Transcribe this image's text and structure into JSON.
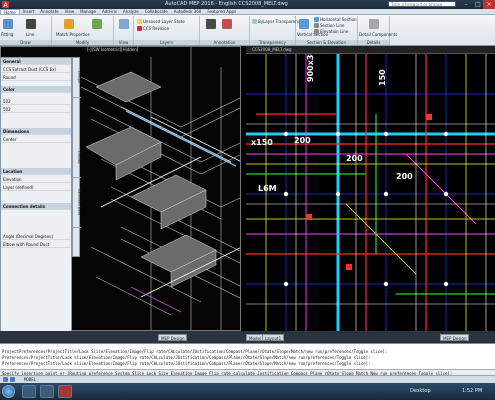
{
  "title_bar": {
    "title": "AutoCAD MEP 2016 - English   CCS2008_MELT.dwg",
    "search_placeholder": "Type a keyword or phrase"
  },
  "menu_tabs": [
    "Home",
    "Insert",
    "Annotate",
    "View",
    "Manage",
    "Add-ins",
    "Analyze",
    "Collaborate",
    "Autodesk 360",
    "Featured Apps"
  ],
  "ribbon": {
    "panels": [
      "Draw",
      "Modify",
      "View",
      "Layers",
      "Annotation",
      "Transparency",
      "Section & Elevation",
      "Details"
    ],
    "buttons": {
      "line": "Line",
      "fitting": "Fitting",
      "match_properties": "Match Properties",
      "unsaved_layer_state": "Unsaved Layer State",
      "ccs_revision": "CCS Revision",
      "bylayer_transparency": "ByLayer Transparency",
      "horizontal_section": "Horizontal Section",
      "section_line": "Section Line",
      "elevation_line": "Elevation Line",
      "vertical_section": "Vertical Section",
      "detail_components": "Detail Components"
    }
  },
  "left_viewport": {
    "label": "[-][SW Isometric][Hidden]"
  },
  "right_viewport": {
    "tab": "CCS2008_MELT.dwg",
    "dims": [
      "900x300",
      "200",
      "200",
      "150",
      "x150",
      "200",
      "L6M"
    ]
  },
  "properties_palette": {
    "rows": [
      "General",
      "CCS Extract Duct (CCS Ex)",
      "Round",
      "Color",
      "502",
      "502",
      "Dimensions",
      "Center",
      "Location",
      "Elevation",
      "Layer (defined)",
      "Connection details",
      "Angle (Decimal Degrees)",
      "Elbow with Round Duct"
    ],
    "side_tabs": [
      "Design",
      "Display",
      "Extended Data"
    ]
  },
  "layout_tabs": [
    "Model",
    "Layout1",
    "MEP Design"
  ],
  "command_history": [
    "ProjectPreferences/ProjectTitle/Lock Slice/Elevation/Image/Flip rate/CALculate/JUstification/Compass/Plane/rOtate/Slope/Match/new run/preferences/Toggle slice]:",
    "Preferences/ProjectTitle/Lock slice/Elevation/Image/Flip rate/CALculate/JUstification/Compass/Plane/rOtate/Slope/Match/new run/preferences/Toggle slice]:",
    "Preferences/ProjectTitle/Lock slice/Elevation/Image/Flip rate/CALculate/JUstification/Compass/Plane/rOtate/Slope/Match/new run/preferences/Toggle slice]:"
  ],
  "command_input": "Specify insertion point or [Routing preference System Slice Lock Size Elevation Image Flip rate calculate Justification Compass Plane rOtate Slope Match New run preferences Toggle slice]:",
  "status_bar": {
    "coords": "MODEL"
  },
  "taskbar": {
    "desktop_label": "Desktop",
    "clock": "1:52 PM"
  }
}
